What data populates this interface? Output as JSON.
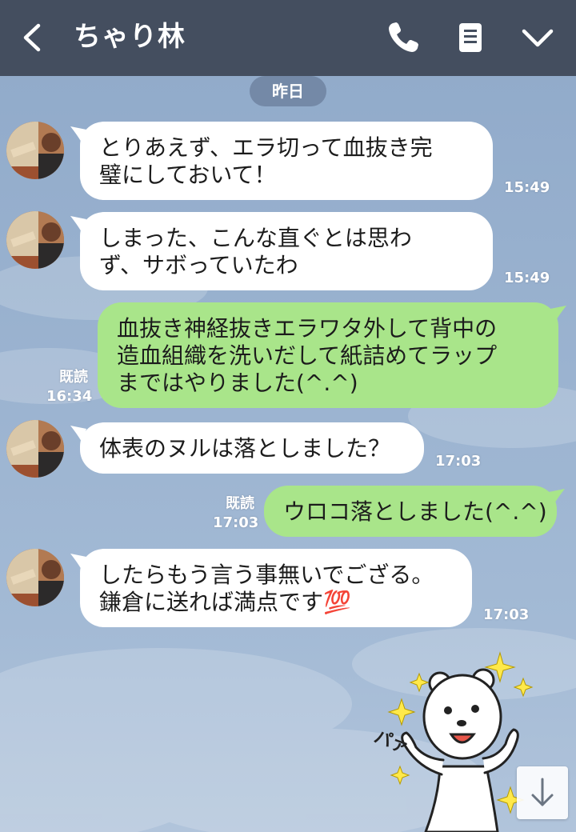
{
  "header": {
    "title": "ちゃり林",
    "back_icon": "chevron-left-icon",
    "call_icon": "phone-icon",
    "notes_icon": "document-icon",
    "menu_icon": "chevron-down-icon",
    "bg_color": "#444e5f"
  },
  "date_divider": "昨日",
  "messages": [
    {
      "sender": "in",
      "lines": [
        "とりあえず、エラ切って血抜き完",
        "璧にしておいて！"
      ],
      "time": "15:49"
    },
    {
      "sender": "in",
      "lines": [
        "しまった、こんな直ぐとは思わ",
        "ず、サボっていたわ"
      ],
      "time": "15:49"
    },
    {
      "sender": "out",
      "lines": [
        "血抜き神経抜きエラワタ外して背中の",
        "造血組織を洗いだして紙詰めてラップ",
        "まではやりました(^.^)"
      ],
      "read": "既読",
      "time": "16:34"
    },
    {
      "sender": "in",
      "lines": [
        "体表のヌルは落としました？"
      ],
      "time": "17:03"
    },
    {
      "sender": "out",
      "lines": [
        "ウロコ落としました(^.^)"
      ],
      "read": "既読",
      "time": "17:03"
    },
    {
      "sender": "in",
      "lines": [
        "したらもう言う事無いでござる。",
        "鎌倉に送れば満点です💯"
      ],
      "time": "17:03"
    }
  ],
  "sticker": {
    "name": "bear-sticker",
    "text": "パァ"
  },
  "scroll_button_icon": "arrow-down-icon",
  "colors": {
    "incoming_bubble": "#ffffff",
    "outgoing_bubble": "#a9e58a",
    "background": "#9bb3d0"
  }
}
